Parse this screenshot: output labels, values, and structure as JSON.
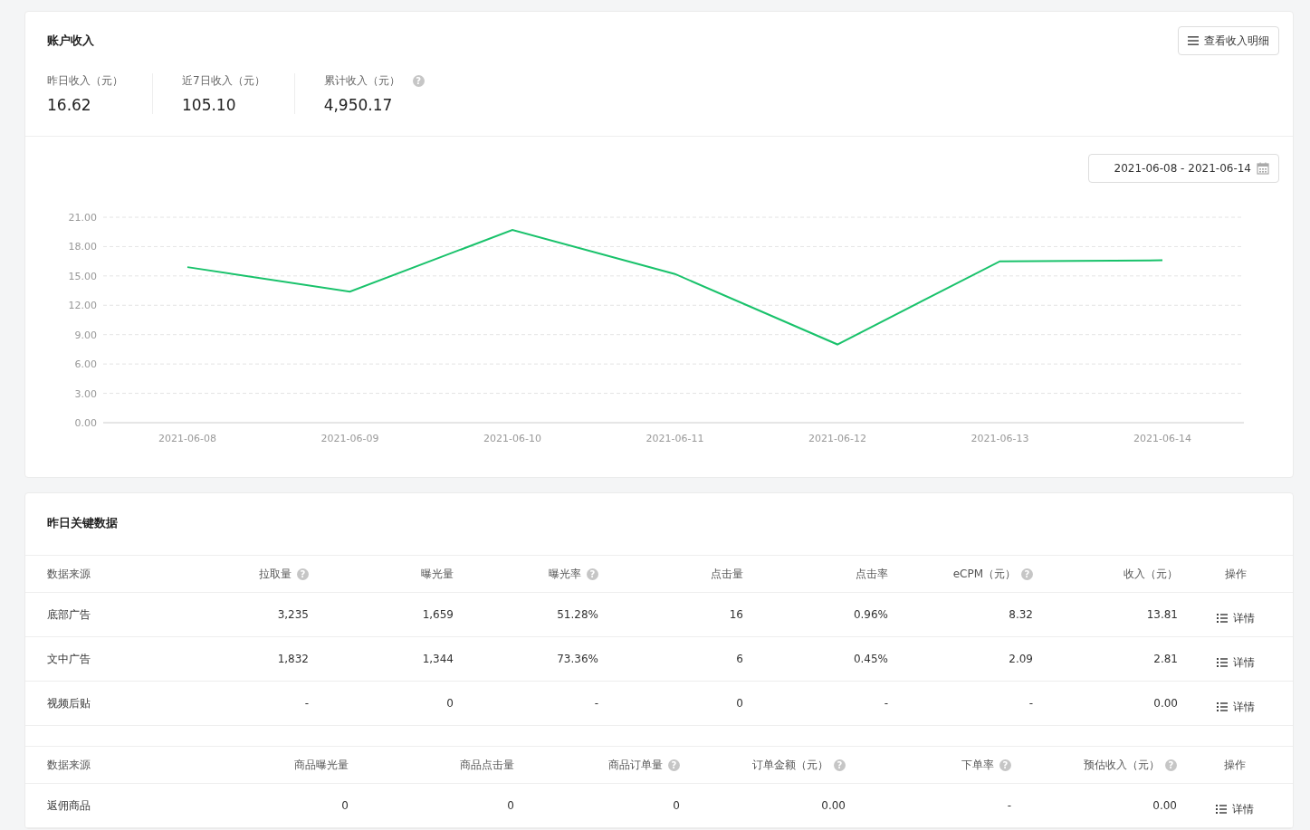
{
  "income_card": {
    "title": "账户收入",
    "detail_button": "查看收入明细",
    "stats": [
      {
        "label": "昨日收入（元）",
        "value": "16.62"
      },
      {
        "label": "近7日收入（元）",
        "value": "105.10"
      },
      {
        "label": "累计收入（元）",
        "value": "4,950.17",
        "help_icon": "?"
      }
    ],
    "date_range": "2021-06-08 - 2021-06-14",
    "chart_data": {
      "type": "line",
      "grid": true,
      "categories": [
        "2021-06-08",
        "2021-06-09",
        "2021-06-10",
        "2021-06-11",
        "2021-06-12",
        "2021-06-13",
        "2021-06-14"
      ],
      "series": [
        {
          "color": "#19c26b",
          "values": [
            15.9,
            13.4,
            19.7,
            15.2,
            8.0,
            16.5,
            16.6
          ]
        }
      ],
      "ylim": [
        0,
        21
      ],
      "yticks": [
        {
          "value": 0,
          "label": "0.00"
        },
        {
          "value": 3,
          "label": "3.00"
        },
        {
          "value": 6,
          "label": "6.00"
        },
        {
          "value": 9,
          "label": "9.00"
        },
        {
          "value": 12,
          "label": "12.00"
        },
        {
          "value": 15,
          "label": "15.00"
        },
        {
          "value": 18,
          "label": "18.00"
        },
        {
          "value": 21,
          "label": "21.00"
        }
      ]
    }
  },
  "key_data_card": {
    "title": "昨日关键数据",
    "tables": [
      {
        "columns": [
          {
            "label": "数据来源"
          },
          {
            "label": "拉取量",
            "help_icon": "?"
          },
          {
            "label": "曝光量"
          },
          {
            "label": "曝光率",
            "help_icon": "?"
          },
          {
            "label": "点击量"
          },
          {
            "label": "点击率"
          },
          {
            "label": "eCPM（元）",
            "help_icon": "?"
          },
          {
            "label": "收入（元）"
          },
          {
            "label": "操作"
          }
        ],
        "rows": [
          {
            "source": "底部广告",
            "values": [
              "3,235",
              "1,659",
              "51.28%",
              "16",
              "0.96%",
              "8.32",
              "13.81"
            ],
            "action": "详情"
          },
          {
            "source": "文中广告",
            "values": [
              "1,832",
              "1,344",
              "73.36%",
              "6",
              "0.45%",
              "2.09",
              "2.81"
            ],
            "action": "详情"
          },
          {
            "source": "视频后贴",
            "values": [
              "-",
              "0",
              "-",
              "0",
              "-",
              "-",
              "0.00"
            ],
            "action": "详情"
          }
        ]
      },
      {
        "columns": [
          {
            "label": "数据来源"
          },
          {
            "label": "商品曝光量"
          },
          {
            "label": "商品点击量"
          },
          {
            "label": "商品订单量",
            "help_icon": "?"
          },
          {
            "label": "订单金额（元）",
            "help_icon": "?"
          },
          {
            "label": "下单率",
            "help_icon": "?"
          },
          {
            "label": "预估收入（元）",
            "help_icon": "?"
          },
          {
            "label": "操作"
          }
        ],
        "rows": [
          {
            "source": "返佣商品",
            "values": [
              "0",
              "0",
              "0",
              "0.00",
              "-",
              "0.00"
            ],
            "action": "详情"
          }
        ]
      }
    ]
  }
}
